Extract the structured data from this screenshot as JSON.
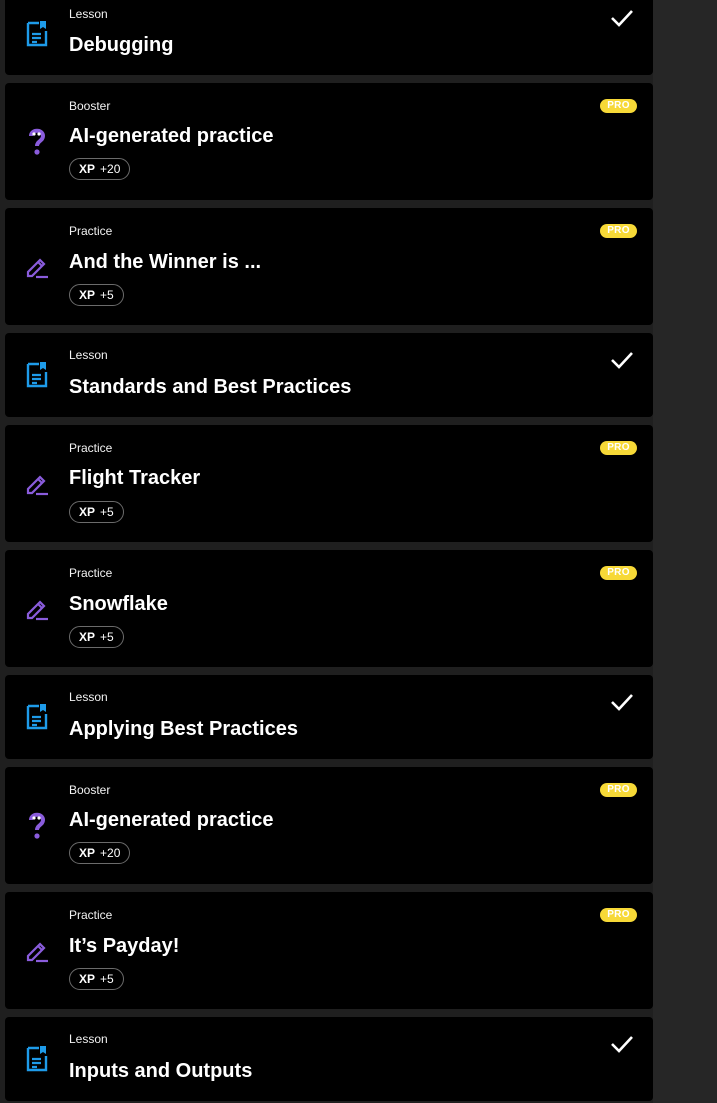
{
  "colors": {
    "lesson_icon": "#1e9be9",
    "practice_icon": "#8a5cdc",
    "booster_icon": "#8a5cdc",
    "pro_badge": "#f7d937",
    "card_bg": "#000000",
    "page_bg": "#1f1f1f"
  },
  "items": [
    {
      "kind": "Lesson",
      "title": "Debugging",
      "icon": "lesson-icon",
      "status": "completed"
    },
    {
      "kind": "Booster",
      "title": "AI-generated practice",
      "icon": "booster-question-icon",
      "xp_label": "XP",
      "xp_value": "+20",
      "badge": "PRO"
    },
    {
      "kind": "Practice",
      "title": "And the Winner is ...",
      "icon": "practice-pencil-icon",
      "xp_label": "XP",
      "xp_value": "+5",
      "badge": "PRO"
    },
    {
      "kind": "Lesson",
      "title": "Standards and Best Practices",
      "icon": "lesson-icon",
      "status": "completed"
    },
    {
      "kind": "Practice",
      "title": "Flight Tracker",
      "icon": "practice-pencil-icon",
      "xp_label": "XP",
      "xp_value": "+5",
      "badge": "PRO"
    },
    {
      "kind": "Practice",
      "title": "Snowflake",
      "icon": "practice-pencil-icon",
      "xp_label": "XP",
      "xp_value": "+5",
      "badge": "PRO"
    },
    {
      "kind": "Lesson",
      "title": "Applying Best Practices",
      "icon": "lesson-icon",
      "status": "completed"
    },
    {
      "kind": "Booster",
      "title": "AI-generated practice",
      "icon": "booster-question-icon",
      "xp_label": "XP",
      "xp_value": "+20",
      "badge": "PRO"
    },
    {
      "kind": "Practice",
      "title": "It’s Payday!",
      "icon": "practice-pencil-icon",
      "xp_label": "XP",
      "xp_value": "+5",
      "badge": "PRO"
    },
    {
      "kind": "Lesson",
      "title": "Inputs and Outputs",
      "icon": "lesson-icon",
      "status": "completed"
    }
  ]
}
